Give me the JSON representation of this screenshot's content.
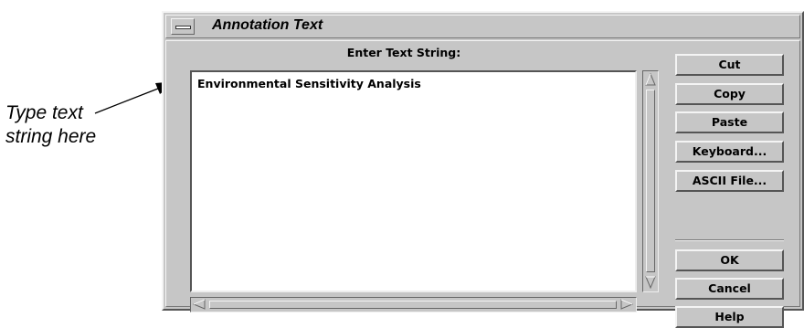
{
  "callout": {
    "line1": "Type text",
    "line2": "string here"
  },
  "dialog": {
    "title": "Annotation Text",
    "window_menu_icon": "window-menu-icon",
    "prompt": "Enter Text String:",
    "text_value": "Environmental Sensitivity Analysis",
    "buttons": {
      "cut": "Cut",
      "copy": "Copy",
      "paste": "Paste",
      "keyboard": "Keyboard...",
      "ascii_file": "ASCII File...",
      "ok": "OK",
      "cancel": "Cancel",
      "help": "Help"
    }
  },
  "colors": {
    "dialog_bg": "#c6c6c6",
    "textbox_bg": "#ffffff"
  }
}
